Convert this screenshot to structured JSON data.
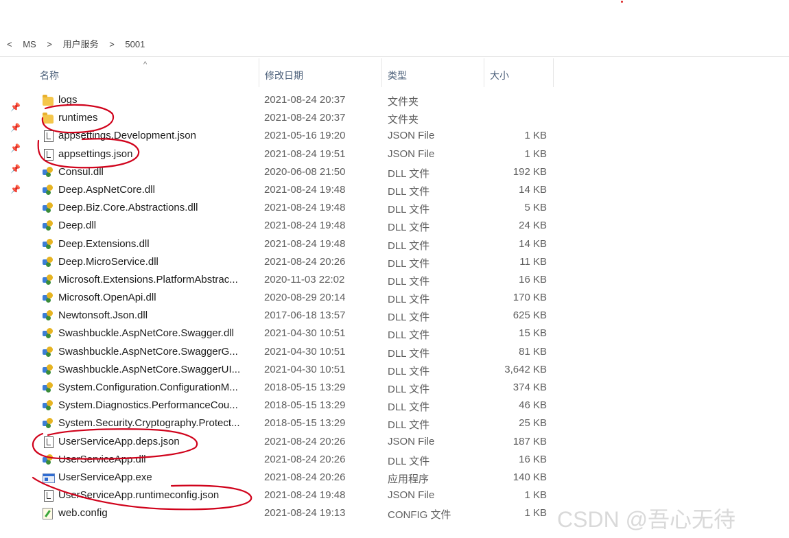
{
  "breadcrumb": [
    "<",
    "MS",
    ">",
    "用户服务",
    ">",
    "5001"
  ],
  "columns": {
    "name": "名称",
    "date": "修改日期",
    "type": "类型",
    "size": "大小"
  },
  "files": [
    {
      "name": "logs",
      "date": "2021-08-24 20:37",
      "type": "文件夹",
      "size": "",
      "icon": "folder-icon"
    },
    {
      "name": "runtimes",
      "date": "2021-08-24 20:37",
      "type": "文件夹",
      "size": "",
      "icon": "folder-icon"
    },
    {
      "name": "appsettings.Development.json",
      "date": "2021-05-16 19:20",
      "type": "JSON File",
      "size": "1 KB",
      "icon": "json-file-icon"
    },
    {
      "name": "appsettings.json",
      "date": "2021-08-24 19:51",
      "type": "JSON File",
      "size": "1 KB",
      "icon": "json-file-icon"
    },
    {
      "name": "Consul.dll",
      "date": "2020-06-08 21:50",
      "type": "DLL 文件",
      "size": "192 KB",
      "icon": "dll-file-icon"
    },
    {
      "name": "Deep.AspNetCore.dll",
      "date": "2021-08-24 19:48",
      "type": "DLL 文件",
      "size": "14 KB",
      "icon": "dll-file-icon"
    },
    {
      "name": "Deep.Biz.Core.Abstractions.dll",
      "date": "2021-08-24 19:48",
      "type": "DLL 文件",
      "size": "5 KB",
      "icon": "dll-file-icon"
    },
    {
      "name": "Deep.dll",
      "date": "2021-08-24 19:48",
      "type": "DLL 文件",
      "size": "24 KB",
      "icon": "dll-file-icon"
    },
    {
      "name": "Deep.Extensions.dll",
      "date": "2021-08-24 19:48",
      "type": "DLL 文件",
      "size": "14 KB",
      "icon": "dll-file-icon"
    },
    {
      "name": "Deep.MicroService.dll",
      "date": "2021-08-24 20:26",
      "type": "DLL 文件",
      "size": "11 KB",
      "icon": "dll-file-icon"
    },
    {
      "name": "Microsoft.Extensions.PlatformAbstrac...",
      "date": "2020-11-03 22:02",
      "type": "DLL 文件",
      "size": "16 KB",
      "icon": "dll-file-icon"
    },
    {
      "name": "Microsoft.OpenApi.dll",
      "date": "2020-08-29 20:14",
      "type": "DLL 文件",
      "size": "170 KB",
      "icon": "dll-file-icon"
    },
    {
      "name": "Newtonsoft.Json.dll",
      "date": "2017-06-18 13:57",
      "type": "DLL 文件",
      "size": "625 KB",
      "icon": "dll-file-icon"
    },
    {
      "name": "Swashbuckle.AspNetCore.Swagger.dll",
      "date": "2021-04-30 10:51",
      "type": "DLL 文件",
      "size": "15 KB",
      "icon": "dll-file-icon"
    },
    {
      "name": "Swashbuckle.AspNetCore.SwaggerG...",
      "date": "2021-04-30 10:51",
      "type": "DLL 文件",
      "size": "81 KB",
      "icon": "dll-file-icon"
    },
    {
      "name": "Swashbuckle.AspNetCore.SwaggerUI...",
      "date": "2021-04-30 10:51",
      "type": "DLL 文件",
      "size": "3,642 KB",
      "icon": "dll-file-icon"
    },
    {
      "name": "System.Configuration.ConfigurationM...",
      "date": "2018-05-15 13:29",
      "type": "DLL 文件",
      "size": "374 KB",
      "icon": "dll-file-icon"
    },
    {
      "name": "System.Diagnostics.PerformanceCou...",
      "date": "2018-05-15 13:29",
      "type": "DLL 文件",
      "size": "46 KB",
      "icon": "dll-file-icon"
    },
    {
      "name": "System.Security.Cryptography.Protect...",
      "date": "2018-05-15 13:29",
      "type": "DLL 文件",
      "size": "25 KB",
      "icon": "dll-file-icon"
    },
    {
      "name": "UserServiceApp.deps.json",
      "date": "2021-08-24 20:26",
      "type": "JSON File",
      "size": "187 KB",
      "icon": "json-file-icon"
    },
    {
      "name": "UserServiceApp.dll",
      "date": "2021-08-24 20:26",
      "type": "DLL 文件",
      "size": "16 KB",
      "icon": "dll-file-icon"
    },
    {
      "name": "UserServiceApp.exe",
      "date": "2021-08-24 20:26",
      "type": "应用程序",
      "size": "140 KB",
      "icon": "exe-file-icon"
    },
    {
      "name": "UserServiceApp.runtimeconfig.json",
      "date": "2021-08-24 19:48",
      "type": "JSON File",
      "size": "1 KB",
      "icon": "json-file-icon"
    },
    {
      "name": "web.config",
      "date": "2021-08-24 19:13",
      "type": "CONFIG 文件",
      "size": "1 KB",
      "icon": "config-file-icon"
    }
  ],
  "watermark": "CSDN @吾心无待",
  "colors": {
    "annotation": "#d0021b",
    "header_text": "#4c607a"
  }
}
